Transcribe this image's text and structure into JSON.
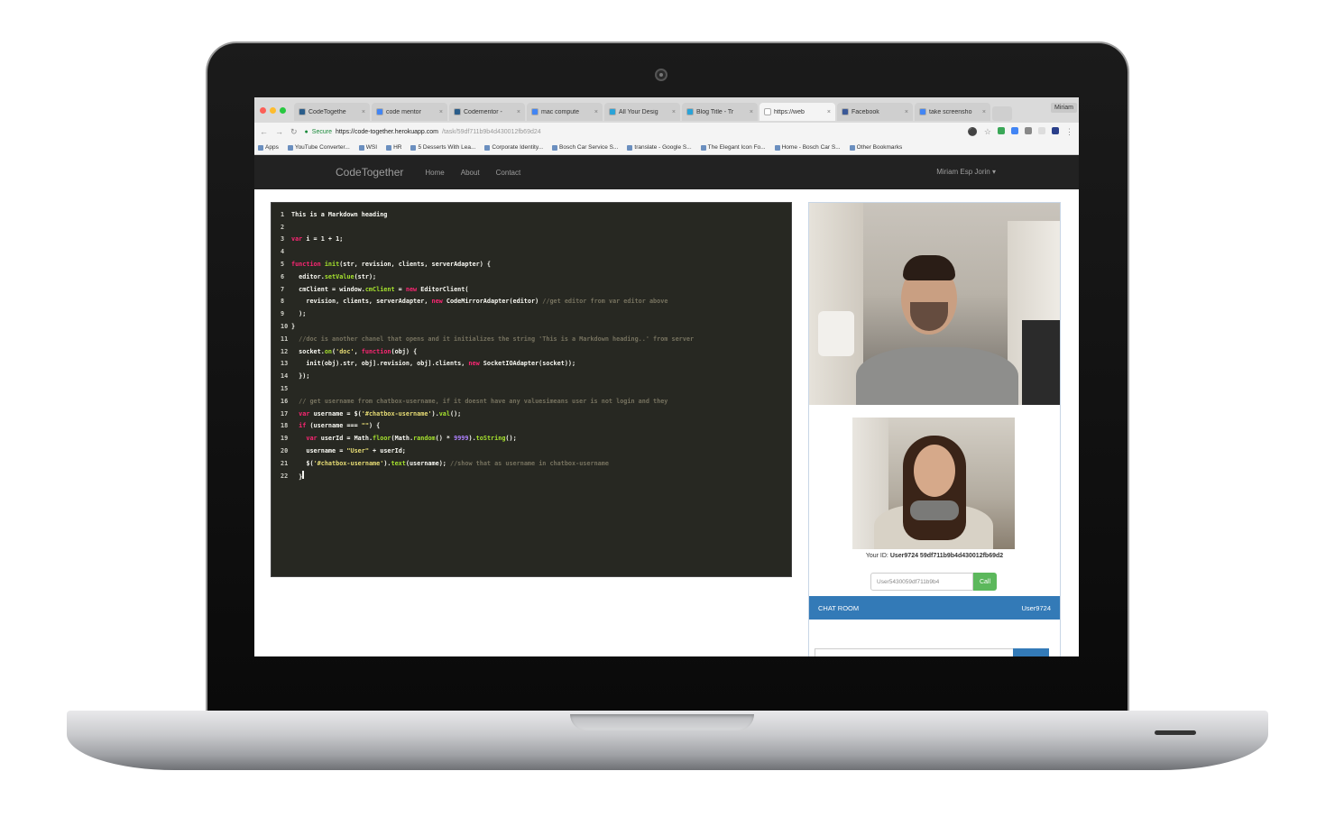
{
  "browser": {
    "tabs": [
      {
        "label": "CodeTogethe",
        "color": "#2a5d8a"
      },
      {
        "label": "code mentor",
        "color": "#4285f4"
      },
      {
        "label": "Codementor - ",
        "color": "#2a5d8a"
      },
      {
        "label": "mac compute",
        "color": "#4285f4"
      },
      {
        "label": "All Your Desig",
        "color": "#2aa3d8"
      },
      {
        "label": "Blog Title - Tr",
        "color": "#2aa3d8"
      },
      {
        "label": "https://web",
        "color": "#ffffff"
      },
      {
        "label": "Facebook",
        "color": "#3b5998"
      },
      {
        "label": "take screensho",
        "color": "#4285f4"
      }
    ],
    "profile_label": "Miriam",
    "secure_label": "Secure",
    "url_host": "https://code-together.herokuapp.com",
    "url_path": "/task/59df711b9b4d430012fb69d24",
    "bookmarks": [
      "Apps",
      "YouTube Converter...",
      "WSI",
      "HR",
      "5 Desserts With Lea...",
      "Corporate Identity...",
      "Bosch Car Service S...",
      "translate - Google S...",
      "The Elegant Icon Fo...",
      "Home - Bosch Car S...",
      "Other Bookmarks"
    ]
  },
  "app_nav": {
    "brand": "CodeTogether",
    "links": [
      "Home",
      "About",
      "Contact"
    ],
    "user": "Miriam Esp Jorin ▾"
  },
  "editor": {
    "theme_bg": "#272822",
    "lines": [
      [
        [
          "tx",
          "This is a Markdown heading"
        ]
      ],
      [],
      [
        [
          "kw",
          "var "
        ],
        [
          "tx",
          "i = 1 + 1;"
        ]
      ],
      [],
      [
        [
          "kw",
          "function "
        ],
        [
          "fn",
          "init"
        ],
        [
          "tx",
          "(str, revision, clients, serverAdapter) {"
        ]
      ],
      [
        [
          "tx",
          "  editor."
        ],
        [
          "fn",
          "setValue"
        ],
        [
          "tx",
          "(str);"
        ]
      ],
      [
        [
          "tx",
          "  cmClient = window."
        ],
        [
          "fn",
          "cmClient"
        ],
        [
          "tx",
          " = "
        ],
        [
          "kw",
          "new "
        ],
        [
          "tx",
          "EditorClient("
        ]
      ],
      [
        [
          "tx",
          "    revision, clients, serverAdapter, "
        ],
        [
          "kw",
          "new "
        ],
        [
          "tx",
          "CodeMirrorAdapter(editor) "
        ],
        [
          "cm",
          "//get editor from var editor above"
        ]
      ],
      [
        [
          "tx",
          "  );"
        ]
      ],
      [
        [
          "tx",
          "}"
        ]
      ],
      [
        [
          "cm",
          "  //doc is another chanel that opens and it initializes the string 'This is a Markdown heading..' from server"
        ]
      ],
      [
        [
          "tx",
          "  socket."
        ],
        [
          "fn",
          "on"
        ],
        [
          "tx",
          "("
        ],
        [
          "str",
          "'doc'"
        ],
        [
          "tx",
          ", "
        ],
        [
          "kw",
          "function"
        ],
        [
          "tx",
          "(obj) {"
        ]
      ],
      [
        [
          "tx",
          "    init(obj).str, obj].revision, obj].clients, "
        ],
        [
          "kw",
          "new "
        ],
        [
          "tx",
          "SocketIOAdapter(socket));"
        ]
      ],
      [
        [
          "tx",
          "  });"
        ]
      ],
      [],
      [
        [
          "cm",
          "  // get username from chatbox-username, if it doesnt have any valuesimeans user is not login and they"
        ]
      ],
      [
        [
          "kw",
          "  var "
        ],
        [
          "tx",
          "username = $("
        ],
        [
          "str",
          "'#chatbox-username'"
        ],
        [
          "tx",
          ")."
        ],
        [
          "fn",
          "val"
        ],
        [
          "tx",
          "();"
        ]
      ],
      [
        [
          "kw",
          "  if "
        ],
        [
          "tx",
          "(username === "
        ],
        [
          "str",
          "\"\""
        ],
        [
          "tx",
          ") {"
        ]
      ],
      [
        [
          "kw",
          "    var "
        ],
        [
          "tx",
          "userId = Math."
        ],
        [
          "fn",
          "floor"
        ],
        [
          "tx",
          "(Math."
        ],
        [
          "fn",
          "random"
        ],
        [
          "tx",
          "() * "
        ],
        [
          "num",
          "9999"
        ],
        [
          "tx",
          ")."
        ],
        [
          "fn",
          "toString"
        ],
        [
          "tx",
          "();"
        ]
      ],
      [
        [
          "tx",
          "    username = "
        ],
        [
          "str",
          "\"User\""
        ],
        [
          "tx",
          " + userId;"
        ]
      ],
      [
        [
          "tx",
          "    $("
        ],
        [
          "str",
          "'#chatbox-username'"
        ],
        [
          "tx",
          ")."
        ],
        [
          "fn",
          "text"
        ],
        [
          "tx",
          "(username); "
        ],
        [
          "cm",
          "//show that as username in chatbox-username"
        ]
      ],
      [
        [
          "tx",
          "  }"
        ]
      ]
    ]
  },
  "video": {
    "your_id_label": "Your ID:",
    "your_id_value": "User9724 59df711b9b4d430012fb69d2",
    "call_input_value": "User5430059df711b9b4",
    "call_button": "Call"
  },
  "chat": {
    "header_left": "CHAT ROOM",
    "header_right": "User9724"
  }
}
